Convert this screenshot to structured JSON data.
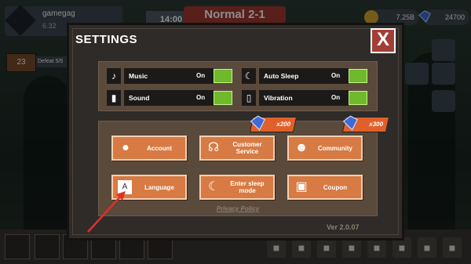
{
  "hud": {
    "player_name": "gamegag",
    "player_sub": "6.32",
    "timer": "14:00",
    "stage": "Normal 2-1",
    "coins": "7.25B",
    "gems": "24700",
    "level": "23",
    "defeat": "Defeat 5/5"
  },
  "settings": {
    "title": "SETTINGS",
    "close": "X",
    "toggles": [
      {
        "label": "Music",
        "state": "On",
        "icon": "music-note-icon"
      },
      {
        "label": "Sound",
        "state": "On",
        "icon": "speaker-icon"
      },
      {
        "label": "Auto Sleep",
        "state": "On",
        "icon": "moon-icon"
      },
      {
        "label": "Vibration",
        "state": "On",
        "icon": "phone-vibration-icon"
      }
    ],
    "buttons": [
      {
        "label": "Account",
        "icon": "person-icon"
      },
      {
        "label": "Customer Service",
        "icon": "headset-icon"
      },
      {
        "label": "Community",
        "icon": "discord-icon"
      },
      {
        "label": "Language",
        "icon": "translate-icon"
      },
      {
        "label": "Enter sleep mode",
        "icon": "sleep-icon"
      },
      {
        "label": "Coupon",
        "icon": "gift-icon"
      }
    ],
    "rewards": [
      {
        "label": "x200",
        "for": "Customer Service"
      },
      {
        "label": "x300",
        "for": "Community"
      }
    ],
    "privacy_label": "Privacy Policy",
    "version": "Ver 2.0.07"
  },
  "colors": {
    "accent_button": "#d77a43",
    "toggle_on": "#6eba2c",
    "close_button": "#a23e36",
    "reward_banner": "#e0602a",
    "annotation_arrow": "#e0302a"
  },
  "lock_icon": "lock-icon"
}
